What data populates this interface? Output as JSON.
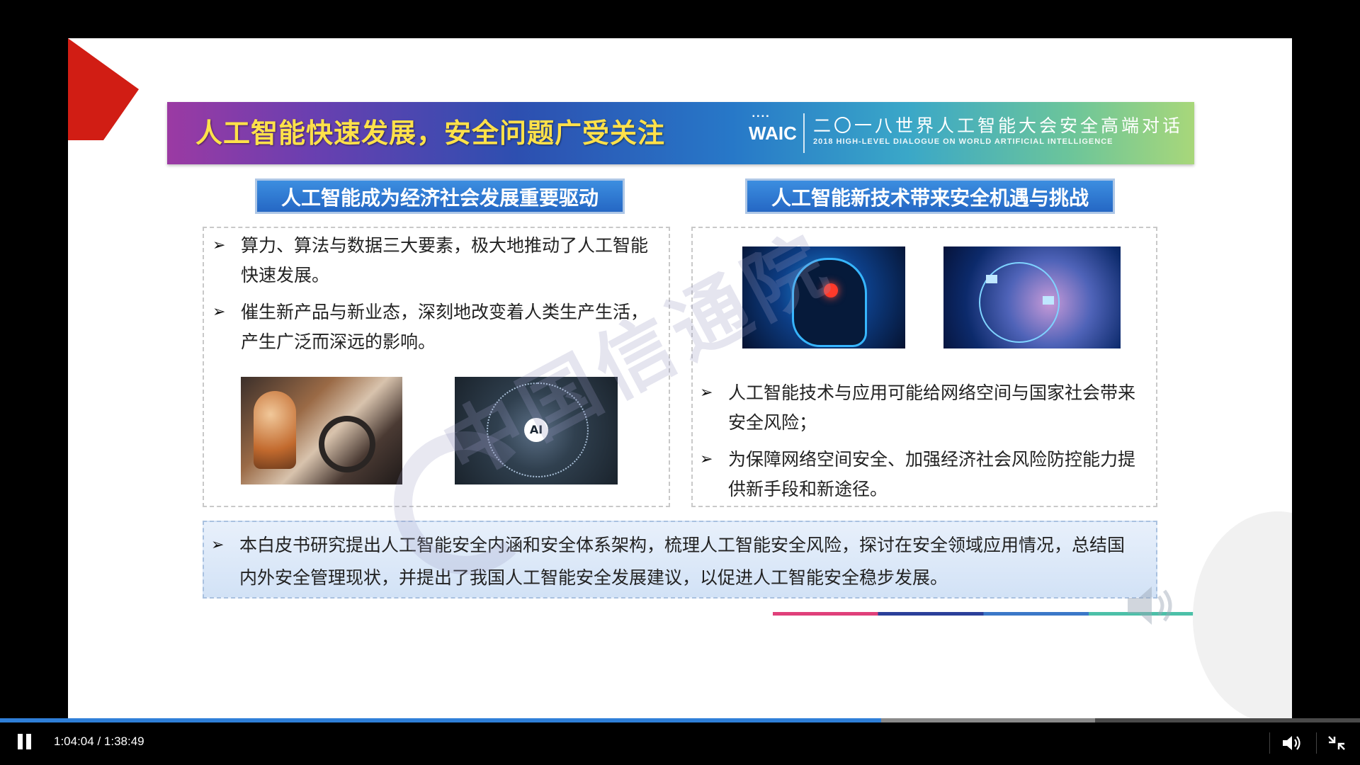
{
  "slide": {
    "title": "人工智能快速发展，安全问题广受关注",
    "logo_text": "WAIC",
    "conference_title": "二〇一八世界人工智能大会安全高端对话",
    "conference_subtitle": "2018 HIGH-LEVEL DIALOGUE ON WORLD ARTIFICIAL INTELLIGENCE",
    "left_header": "人工智能成为经济社会发展重要驱动",
    "right_header": "人工智能新技术带来安全机遇与挑战",
    "left_bullets": [
      "算力、算法与数据三大要素，极大地推动了人工智能快速发展。",
      "催生新产品与新业态，深刻地改变着人类生产生活，产生广泛而深远的影响。"
    ],
    "right_bullets": [
      "人工智能技术与应用可能给网络空间与国家社会带来安全风险；",
      "为保障网络空间安全、加强经济社会风险防控能力提供新手段和新途径。"
    ],
    "bottom_text": "本白皮书研究提出人工智能安全内涵和安全体系架构，梳理人工智能安全风险，探讨在安全领域应用情况，总结国内外安全管理现状，并提出了我国人工智能安全发展建议，以促进人工智能安全稳步发展。",
    "image_ai_label": "AI",
    "watermark": "中国信通院",
    "bullet_glyph": "➢"
  },
  "player": {
    "time_display": "1:04:04 / 1:38:49",
    "progress_fraction": 0.648,
    "buffered_fraction": 0.805,
    "accent_color": "#2f7fd8",
    "icons": [
      "pause-icon",
      "volume-icon",
      "exit-fullscreen-icon"
    ]
  }
}
